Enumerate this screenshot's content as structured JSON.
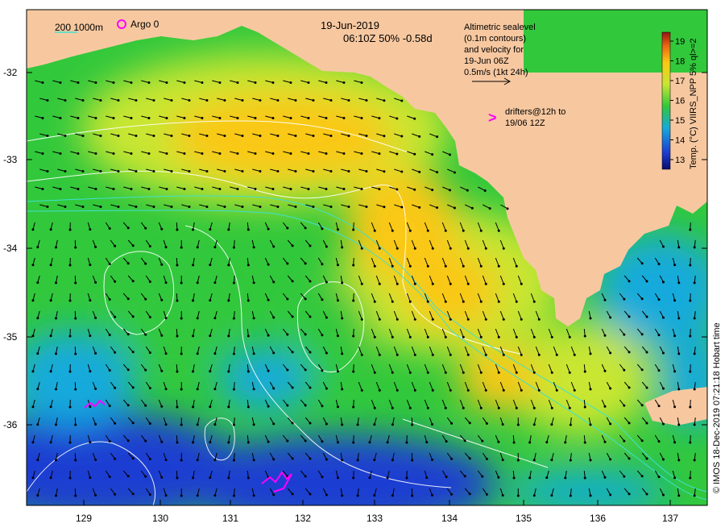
{
  "header": {
    "date": "19-Jun-2019",
    "time_line": "06:10Z  50% -0.58d"
  },
  "legend": {
    "bathy_label": "200  1000m",
    "argo_label": "Argo 0",
    "altimetry_lines": [
      "Altimetric sealevel",
      "(0.1m contours)",
      "and velocity for",
      "19-Jun 06Z",
      "0.5m/s (1kt 24h)"
    ],
    "drifters_lines": [
      "drifters@12h to",
      "19/06 12Z"
    ],
    "drifter_marker": ">"
  },
  "colorbar": {
    "title": "Temp. (°C) VIIRS_NPP 5% ql>=2",
    "ticks": [
      "13",
      "14",
      "15",
      "16",
      "17",
      "18",
      "19"
    ]
  },
  "axes": {
    "lat_labels": [
      "-32",
      "-33",
      "-34",
      "-35",
      "-36"
    ],
    "lon_labels": [
      "129",
      "130",
      "131",
      "132",
      "133",
      "134",
      "135",
      "136",
      "137"
    ]
  },
  "credit": "© IMOS 18-Dec-2019 07:21:18 Hobart time",
  "colors": {
    "land": "#f7c8a0",
    "sst_cold": "#1e3cd2",
    "sst_cool": "#14aadc",
    "sst_mid": "#32c83c",
    "sst_warm": "#c8e632",
    "sst_hot": "#fac814",
    "drifter": "#ff00ff",
    "contour": "#ffffff",
    "bathy_200": "#40e0d0"
  }
}
